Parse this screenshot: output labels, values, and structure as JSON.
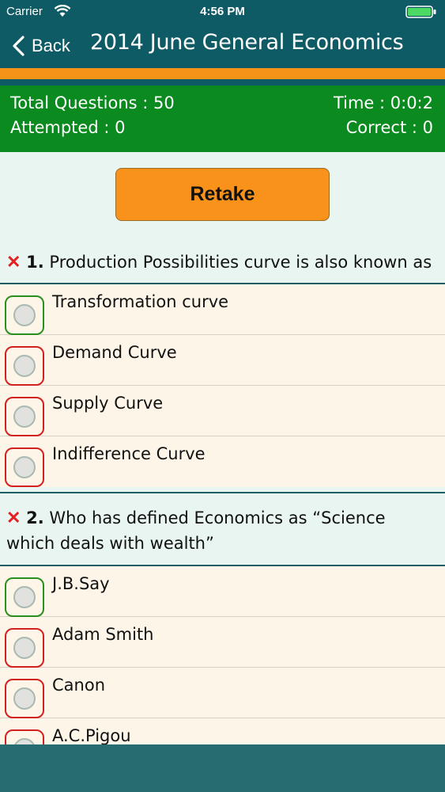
{
  "status": {
    "carrier": "Carrier",
    "time": "4:56 PM"
  },
  "nav": {
    "back_label": "Back",
    "title": "2014 June General Economics"
  },
  "summary": {
    "total": "Total Questions : 50",
    "attempted": "Attempted : 0",
    "time": "Time : 0:0:2",
    "correct": "Correct : 0"
  },
  "retake_label": "Retake",
  "questions": [
    {
      "mark": "✕",
      "number": "1.",
      "text": "Production Possibilities curve is also known as",
      "options": [
        {
          "label": "Transformation curve",
          "correct": true
        },
        {
          "label": "Demand Curve",
          "correct": false
        },
        {
          "label": "Supply Curve",
          "correct": false
        },
        {
          "label": "Indifference Curve",
          "correct": false
        }
      ]
    },
    {
      "mark": "✕",
      "number": "2.",
      "text_line1": "Who has defined Economics as “Science",
      "text_line2": "which deals with wealth”",
      "options": [
        {
          "label": "J.B.Say",
          "correct": true
        },
        {
          "label": "Adam Smith",
          "correct": false
        },
        {
          "label": "Canon",
          "correct": false
        },
        {
          "label": "A.C.Pigou",
          "correct": false
        }
      ]
    }
  ],
  "colors": {
    "header": "#0f5b65",
    "accent": "#f39318",
    "summary": "#0b8a1f",
    "wrong": "#d32020",
    "correct": "#2a8f1f"
  }
}
